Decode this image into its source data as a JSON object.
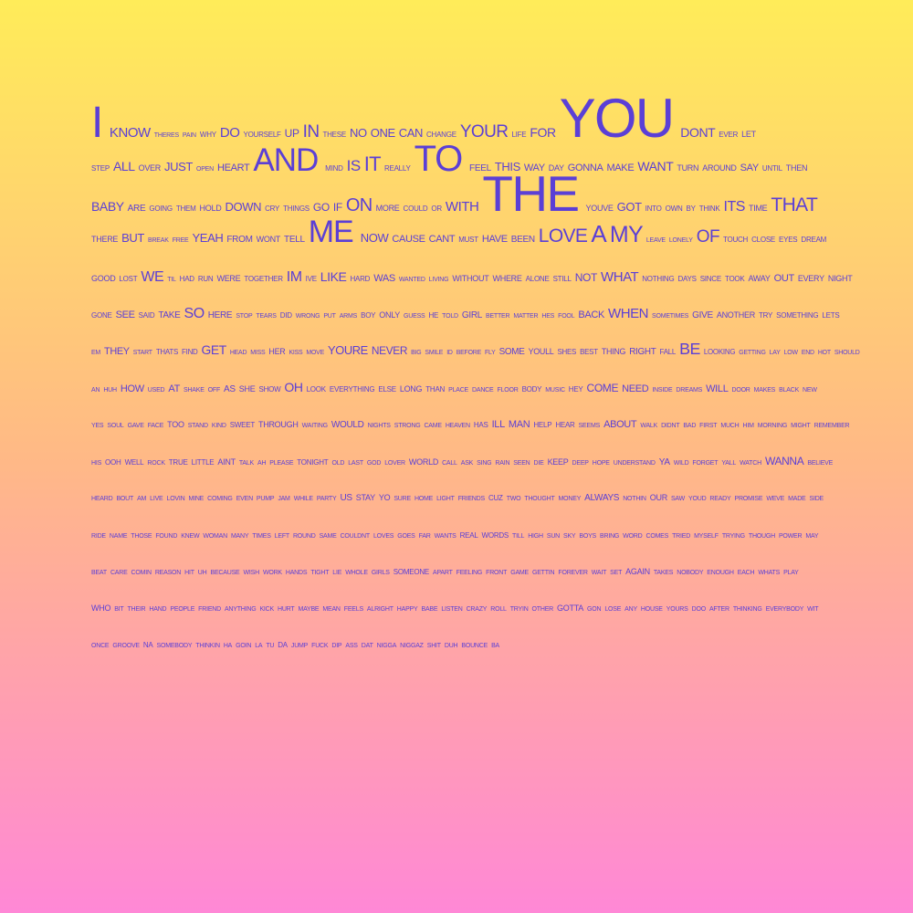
{
  "text_color": "#5b3fd6",
  "background": {
    "top": "#FFEC59",
    "middle": "#FFB986",
    "bottom": "#FF88D6"
  },
  "lines": [
    [
      [
        "I",
        48
      ],
      [
        "KNOW",
        15
      ],
      [
        "THERES",
        7
      ],
      [
        "PAIN",
        7
      ],
      [
        "WHY",
        8
      ],
      [
        "DO",
        15
      ],
      [
        "YOURSELF",
        8
      ],
      [
        "UP",
        12
      ],
      [
        "IN",
        19
      ],
      [
        "THESE",
        8
      ],
      [
        "NO",
        13
      ],
      [
        "ONE",
        13
      ],
      [
        "CAN",
        13
      ],
      [
        "CHANGE",
        8
      ],
      [
        "YOUR",
        19
      ],
      [
        "LIFE",
        8
      ],
      [
        "FOR",
        14
      ],
      [
        "YOU",
        60
      ],
      [
        "DONT",
        14
      ],
      [
        "EVER",
        8
      ],
      [
        "LET",
        9
      ]
    ],
    [
      [
        "STEP",
        8
      ],
      [
        "ALL",
        14
      ],
      [
        "OVER",
        9
      ],
      [
        "JUST",
        13
      ],
      [
        "OPEN",
        7
      ],
      [
        "HEART",
        11
      ],
      [
        "AND",
        35
      ],
      [
        "MIND",
        8
      ],
      [
        "IS",
        17
      ],
      [
        "IT",
        22
      ],
      [
        "REALLY",
        8
      ],
      [
        "TO",
        40
      ],
      [
        "FEEL",
        10
      ],
      [
        "THIS",
        13
      ],
      [
        "WAY",
        11
      ],
      [
        "DAY",
        9
      ],
      [
        "GONNA",
        11
      ],
      [
        "MAKE",
        11
      ],
      [
        "WANT",
        14
      ],
      [
        "TURN",
        9
      ],
      [
        "AROUND",
        9
      ],
      [
        "SAY",
        11
      ],
      [
        "UNTIL",
        8
      ],
      [
        "THEN",
        9
      ]
    ],
    [
      [
        "BABY",
        14
      ],
      [
        "ARE",
        10
      ],
      [
        "GOING",
        8
      ],
      [
        "THEM",
        8
      ],
      [
        "HOLD",
        9
      ],
      [
        "DOWN",
        13
      ],
      [
        "CRY",
        8
      ],
      [
        "THINGS",
        8
      ],
      [
        "GO",
        12
      ],
      [
        "IF",
        12
      ],
      [
        "ON",
        20
      ],
      [
        "MORE",
        9
      ],
      [
        "COULD",
        8
      ],
      [
        "OR",
        8
      ],
      [
        "WITH",
        15
      ],
      [
        "THE",
        55
      ],
      [
        "YOUVE",
        9
      ],
      [
        "GOT",
        13
      ],
      [
        "INTO",
        8
      ],
      [
        "OWN",
        8
      ],
      [
        "BY",
        8
      ],
      [
        "THINK",
        8
      ],
      [
        "ITS",
        16
      ],
      [
        "TIME",
        9
      ],
      [
        "THAT",
        21
      ]
    ],
    [
      [
        "THERE",
        9
      ],
      [
        "BUT",
        13
      ],
      [
        "BREAK",
        7
      ],
      [
        "FREE",
        7
      ],
      [
        "YEAH",
        13
      ],
      [
        "FROM",
        10
      ],
      [
        "WONT",
        9
      ],
      [
        "TELL",
        10
      ],
      [
        "ME",
        34
      ],
      [
        "NOW",
        13
      ],
      [
        "CAUSE",
        11
      ],
      [
        "CANT",
        11
      ],
      [
        "MUST",
        8
      ],
      [
        "HAVE",
        11
      ],
      [
        "BEEN",
        10
      ],
      [
        "LOVE",
        21
      ],
      [
        "A",
        26
      ],
      [
        "MY",
        25
      ],
      [
        "LEAVE",
        7
      ],
      [
        "LONELY",
        7
      ],
      [
        "OF",
        19
      ],
      [
        "TOUCH",
        8
      ],
      [
        "CLOSE",
        8
      ],
      [
        "EYES",
        8
      ],
      [
        "DREAM",
        8
      ]
    ],
    [
      [
        "GOOD",
        9
      ],
      [
        "LOST",
        8
      ],
      [
        "WE",
        16
      ],
      [
        "TIL",
        7
      ],
      [
        "HAD",
        8
      ],
      [
        "RUN",
        8
      ],
      [
        "WERE",
        9
      ],
      [
        "TOGETHER",
        8
      ],
      [
        "IM",
        16
      ],
      [
        "IVE",
        8
      ],
      [
        "LIKE",
        14
      ],
      [
        "HARD",
        8
      ],
      [
        "WAS",
        11
      ],
      [
        "WANTED",
        7
      ],
      [
        "LIVING",
        7
      ],
      [
        "WITHOUT",
        9
      ],
      [
        "WHERE",
        9
      ],
      [
        "ALONE",
        8
      ],
      [
        "STILL",
        8
      ],
      [
        "NOT",
        12
      ],
      [
        "WHAT",
        15
      ],
      [
        "NOTHING",
        8
      ],
      [
        "DAYS",
        8
      ],
      [
        "SINCE",
        8
      ],
      [
        "TOOK",
        8
      ],
      [
        "AWAY",
        9
      ],
      [
        "OUT",
        11
      ],
      [
        "EVERY",
        9
      ],
      [
        "NIGHT",
        9
      ]
    ],
    [
      [
        "GONE",
        8
      ],
      [
        "SEE",
        11
      ],
      [
        "SAID",
        8
      ],
      [
        "TAKE",
        10
      ],
      [
        "SO",
        16
      ],
      [
        "HERE",
        10
      ],
      [
        "STOP",
        7
      ],
      [
        "TEARS",
        7
      ],
      [
        "DID",
        8
      ],
      [
        "WRONG",
        7
      ],
      [
        "PUT",
        7
      ],
      [
        "ARMS",
        7
      ],
      [
        "BOY",
        8
      ],
      [
        "ONLY",
        9
      ],
      [
        "GUESS",
        7
      ],
      [
        "HE",
        8
      ],
      [
        "TOLD",
        7
      ],
      [
        "GIRL",
        10
      ],
      [
        "BETTER",
        7
      ],
      [
        "MATTER",
        7
      ],
      [
        "HES",
        7
      ],
      [
        "FOOL",
        7
      ],
      [
        "BACK",
        11
      ],
      [
        "WHEN",
        15
      ],
      [
        "SOMETIMES",
        7
      ],
      [
        "GIVE",
        10
      ],
      [
        "ANOTHER",
        9
      ],
      [
        "TRY",
        8
      ],
      [
        "SOMETHING",
        8
      ],
      [
        "LETS",
        8
      ]
    ],
    [
      [
        "EM",
        7
      ],
      [
        "THEY",
        11
      ],
      [
        "START",
        7
      ],
      [
        "THATS",
        8
      ],
      [
        "FIND",
        8
      ],
      [
        "GET",
        14
      ],
      [
        "HEAD",
        7
      ],
      [
        "MISS",
        7
      ],
      [
        "HER",
        9
      ],
      [
        "KISS",
        7
      ],
      [
        "MOVE",
        7
      ],
      [
        "YOURE",
        13
      ],
      [
        "NEVER",
        12
      ],
      [
        "BIG",
        7
      ],
      [
        "SMILE",
        7
      ],
      [
        "ID",
        7
      ],
      [
        "BEFORE",
        7
      ],
      [
        "FLY",
        7
      ],
      [
        "SOME",
        10
      ],
      [
        "YOULL",
        9
      ],
      [
        "SHES",
        8
      ],
      [
        "BEST",
        8
      ],
      [
        "THING",
        9
      ],
      [
        "RIGHT",
        10
      ],
      [
        "FALL",
        8
      ],
      [
        "BE",
        18
      ],
      [
        "LOOKING",
        8
      ],
      [
        "GETTING",
        7
      ],
      [
        "LAY",
        7
      ],
      [
        "LOW",
        7
      ],
      [
        "END",
        7
      ],
      [
        "HOT",
        7
      ],
      [
        "SHOULD",
        7
      ]
    ],
    [
      [
        "AN",
        7
      ],
      [
        "HUH",
        7
      ],
      [
        "HOW",
        11
      ],
      [
        "USED",
        7
      ],
      [
        "AT",
        11
      ],
      [
        "SHAKE",
        7
      ],
      [
        "OFF",
        7
      ],
      [
        "AS",
        10
      ],
      [
        "SHE",
        9
      ],
      [
        "SHOW",
        8
      ],
      [
        "OH",
        14
      ],
      [
        "LOOK",
        8
      ],
      [
        "EVERYTHING",
        8
      ],
      [
        "ELSE",
        8
      ],
      [
        "LONG",
        9
      ],
      [
        "THAN",
        8
      ],
      [
        "PLACE",
        7
      ],
      [
        "DANCE",
        7
      ],
      [
        "FLOOR",
        7
      ],
      [
        "BODY",
        8
      ],
      [
        "MUSIC",
        7
      ],
      [
        "HEY",
        8
      ],
      [
        "COME",
        12
      ],
      [
        "NEED",
        11
      ],
      [
        "INSIDE",
        7
      ],
      [
        "DREAMS",
        7
      ],
      [
        "WILL",
        11
      ],
      [
        "DOOR",
        7
      ],
      [
        "MAKES",
        7
      ],
      [
        "BLACK",
        7
      ],
      [
        "NEW",
        7
      ]
    ],
    [
      [
        "YES",
        7
      ],
      [
        "SOUL",
        7
      ],
      [
        "GAVE",
        7
      ],
      [
        "FACE",
        7
      ],
      [
        "TOO",
        9
      ],
      [
        "STAND",
        7
      ],
      [
        "KIND",
        7
      ],
      [
        "SWEET",
        8
      ],
      [
        "THROUGH",
        9
      ],
      [
        "WAITING",
        7
      ],
      [
        "WOULD",
        10
      ],
      [
        "NIGHTS",
        7
      ],
      [
        "STRONG",
        7
      ],
      [
        "CAME",
        7
      ],
      [
        "HEAVEN",
        7
      ],
      [
        "HAS",
        8
      ],
      [
        "ILL",
        11
      ],
      [
        "MAN",
        11
      ],
      [
        "HELP",
        8
      ],
      [
        "HEAR",
        8
      ],
      [
        "SEEMS",
        7
      ],
      [
        "ABOUT",
        11
      ],
      [
        "WALK",
        7
      ],
      [
        "DIDNT",
        7
      ],
      [
        "BAD",
        7
      ],
      [
        "FIRST",
        7
      ],
      [
        "MUCH",
        7
      ],
      [
        "HIM",
        7
      ],
      [
        "MORNING",
        7
      ],
      [
        "MIGHT",
        7
      ],
      [
        "REMEMBER",
        7
      ]
    ],
    [
      [
        "HIS",
        7
      ],
      [
        "OOH",
        8
      ],
      [
        "WELL",
        8
      ],
      [
        "ROCK",
        7
      ],
      [
        "TRUE",
        8
      ],
      [
        "LITTLE",
        8
      ],
      [
        "AINT",
        9
      ],
      [
        "TALK",
        7
      ],
      [
        "AH",
        7
      ],
      [
        "PLEASE",
        7
      ],
      [
        "TONIGHT",
        8
      ],
      [
        "OLD",
        7
      ],
      [
        "LAST",
        7
      ],
      [
        "GOD",
        7
      ],
      [
        "LOVER",
        7
      ],
      [
        "WORLD",
        9
      ],
      [
        "CALL",
        7
      ],
      [
        "ASK",
        7
      ],
      [
        "SING",
        7
      ],
      [
        "RAIN",
        7
      ],
      [
        "SEEN",
        7
      ],
      [
        "DIE",
        7
      ],
      [
        "KEEP",
        9
      ],
      [
        "DEEP",
        7
      ],
      [
        "HOPE",
        7
      ],
      [
        "UNDERSTAND",
        7
      ],
      [
        "YA",
        10
      ],
      [
        "WILD",
        7
      ],
      [
        "FORGET",
        7
      ],
      [
        "YALL",
        7
      ],
      [
        "WATCH",
        7
      ],
      [
        "WANNA",
        12
      ],
      [
        "BELIEVE",
        7
      ]
    ],
    [
      [
        "HEARD",
        7
      ],
      [
        "BOUT",
        7
      ],
      [
        "AM",
        7
      ],
      [
        "LIVE",
        7
      ],
      [
        "LOVIN",
        7
      ],
      [
        "MINE",
        7
      ],
      [
        "COMING",
        7
      ],
      [
        "EVEN",
        7
      ],
      [
        "PUMP",
        7
      ],
      [
        "JAM",
        7
      ],
      [
        "WHILE",
        7
      ],
      [
        "PARTY",
        7
      ],
      [
        "US",
        10
      ],
      [
        "STAY",
        9
      ],
      [
        "YO",
        9
      ],
      [
        "SURE",
        7
      ],
      [
        "HOME",
        7
      ],
      [
        "LIGHT",
        7
      ],
      [
        "FRIENDS",
        7
      ],
      [
        "CUZ",
        8
      ],
      [
        "TWO",
        7
      ],
      [
        "THOUGHT",
        7
      ],
      [
        "MONEY",
        7
      ],
      [
        "ALWAYS",
        10
      ],
      [
        "NOTHIN",
        7
      ],
      [
        "OUR",
        9
      ],
      [
        "SAW",
        7
      ],
      [
        "YOUD",
        7
      ],
      [
        "READY",
        7
      ],
      [
        "PROMISE",
        7
      ],
      [
        "WEVE",
        7
      ],
      [
        "MADE",
        7
      ],
      [
        "SIDE",
        7
      ]
    ],
    [
      [
        "RIDE",
        7
      ],
      [
        "NAME",
        7
      ],
      [
        "THOSE",
        7
      ],
      [
        "FOUND",
        7
      ],
      [
        "KNEW",
        7
      ],
      [
        "WOMAN",
        7
      ],
      [
        "MANY",
        7
      ],
      [
        "TIMES",
        7
      ],
      [
        "LEFT",
        7
      ],
      [
        "ROUND",
        7
      ],
      [
        "SAME",
        7
      ],
      [
        "COULDNT",
        7
      ],
      [
        "LOVES",
        7
      ],
      [
        "GOES",
        7
      ],
      [
        "FAR",
        7
      ],
      [
        "WANTS",
        7
      ],
      [
        "REAL",
        8
      ],
      [
        "WORDS",
        8
      ],
      [
        "TILL",
        7
      ],
      [
        "HIGH",
        7
      ],
      [
        "SUN",
        7
      ],
      [
        "SKY",
        7
      ],
      [
        "BOYS",
        7
      ],
      [
        "BRING",
        7
      ],
      [
        "WORD",
        7
      ],
      [
        "COMES",
        7
      ],
      [
        "TRIED",
        7
      ],
      [
        "MYSELF",
        7
      ],
      [
        "TRYING",
        7
      ],
      [
        "THOUGH",
        7
      ],
      [
        "POWER",
        7
      ],
      [
        "MAY",
        7
      ]
    ],
    [
      [
        "BEAT",
        7
      ],
      [
        "CARE",
        7
      ],
      [
        "COMIN",
        7
      ],
      [
        "REASON",
        7
      ],
      [
        "HIT",
        7
      ],
      [
        "UH",
        7
      ],
      [
        "BECAUSE",
        7
      ],
      [
        "WISH",
        7
      ],
      [
        "WORK",
        7
      ],
      [
        "HANDS",
        7
      ],
      [
        "TIGHT",
        7
      ],
      [
        "LIE",
        7
      ],
      [
        "WHOLE",
        7
      ],
      [
        "GIRLS",
        7
      ],
      [
        "SOMEONE",
        8
      ],
      [
        "APART",
        7
      ],
      [
        "FEELING",
        7
      ],
      [
        "FRONT",
        7
      ],
      [
        "GAME",
        7
      ],
      [
        "GETTIN",
        7
      ],
      [
        "FOREVER",
        7
      ],
      [
        "WAIT",
        7
      ],
      [
        "SET",
        7
      ],
      [
        "AGAIN",
        9
      ],
      [
        "TAKES",
        7
      ],
      [
        "NOBODY",
        7
      ],
      [
        "ENOUGH",
        7
      ],
      [
        "EACH",
        7
      ],
      [
        "WHATS",
        7
      ],
      [
        "PLAY",
        7
      ]
    ],
    [
      [
        "WHO",
        9
      ],
      [
        "BIT",
        7
      ],
      [
        "THEIR",
        7
      ],
      [
        "HAND",
        7
      ],
      [
        "PEOPLE",
        7
      ],
      [
        "FRIEND",
        7
      ],
      [
        "ANYTHING",
        7
      ],
      [
        "KICK",
        7
      ],
      [
        "HURT",
        7
      ],
      [
        "MAYBE",
        7
      ],
      [
        "MEAN",
        7
      ],
      [
        "FEELS",
        7
      ],
      [
        "ALRIGHT",
        7
      ],
      [
        "HAPPY",
        7
      ],
      [
        "BABE",
        7
      ],
      [
        "LISTEN",
        7
      ],
      [
        "CRAZY",
        7
      ],
      [
        "ROLL",
        7
      ],
      [
        "TRYIN",
        7
      ],
      [
        "OTHER",
        7
      ],
      [
        "GOTTA",
        9
      ],
      [
        "GON",
        7
      ],
      [
        "LOSE",
        7
      ],
      [
        "ANY",
        7
      ],
      [
        "HOUSE",
        7
      ],
      [
        "YOURS",
        7
      ],
      [
        "DOO",
        7
      ],
      [
        "AFTER",
        7
      ],
      [
        "THINKING",
        7
      ],
      [
        "EVERYBODY",
        7
      ],
      [
        "WIT",
        7
      ]
    ],
    [
      [
        "ONCE",
        7
      ],
      [
        "GROOVE",
        7
      ],
      [
        "NA",
        8
      ],
      [
        "SOMEBODY",
        7
      ],
      [
        "THINKIN",
        7
      ],
      [
        "HA",
        7
      ],
      [
        "GOIN",
        7
      ],
      [
        "LA",
        7
      ],
      [
        "TU",
        7
      ],
      [
        "DA",
        8
      ],
      [
        "JUMP",
        7
      ],
      [
        "FUCK",
        7
      ],
      [
        "DIP",
        7
      ],
      [
        "ASS",
        7
      ],
      [
        "DAT",
        7
      ],
      [
        "NIGGA",
        7
      ],
      [
        "NIGGAZ",
        7
      ],
      [
        "SHIT",
        7
      ],
      [
        "DUH",
        7
      ],
      [
        "BOUNCE",
        7
      ],
      [
        "BA",
        7
      ]
    ]
  ]
}
